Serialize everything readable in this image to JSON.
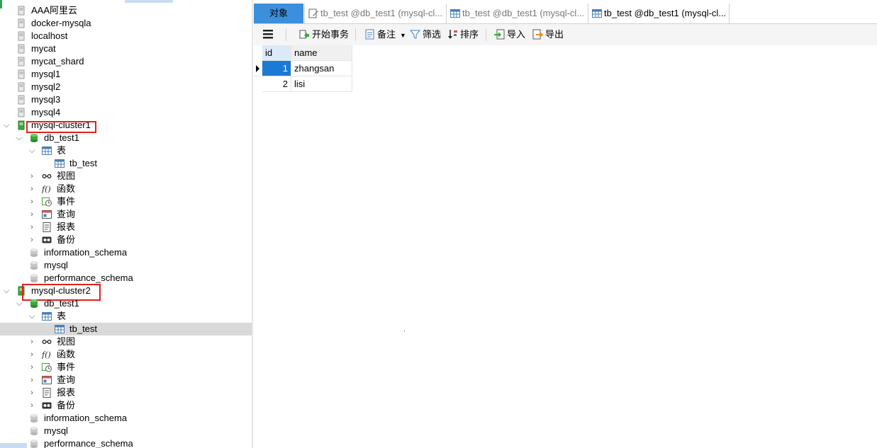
{
  "tree": {
    "connections_top": [
      "AAA阿里云",
      "docker-mysqla",
      "localhost",
      "mycat",
      "mycat_shard",
      "mysql1",
      "mysql2",
      "mysql3",
      "mysql4"
    ],
    "cluster1": {
      "name": "mysql-cluster1",
      "db": "db_test1",
      "tables_label": "表",
      "table": "tb_test",
      "views": "视图",
      "functions": "函数",
      "events": "事件",
      "queries": "查询",
      "reports": "报表",
      "backups": "备份",
      "other_dbs": [
        "information_schema",
        "mysql",
        "performance_schema"
      ]
    },
    "cluster2": {
      "name": "mysql-cluster2",
      "db": "db_test1",
      "tables_label": "表",
      "table": "tb_test",
      "views": "视图",
      "functions": "函数",
      "events": "事件",
      "queries": "查询",
      "reports": "报表",
      "backups": "备份",
      "other_dbs": [
        "information_schema",
        "mysql",
        "performance_schema"
      ]
    }
  },
  "tabs": {
    "objects": "对象",
    "doc1": "tb_test @db_test1 (mysql-cl...",
    "doc2": "tb_test @db_test1 (mysql-cl...",
    "doc3": "tb_test @db_test1 (mysql-cl..."
  },
  "toolbar": {
    "begin_transaction": "开始事务",
    "memo": "备注",
    "filter": "筛选",
    "sort": "排序",
    "import": "导入",
    "export": "导出"
  },
  "grid": {
    "columns": [
      "id",
      "name"
    ],
    "rows": [
      {
        "id": "1",
        "name": "zhangsan"
      },
      {
        "id": "2",
        "name": "lisi"
      }
    ]
  },
  "colors": {
    "accent_tab": "#3c8fdd",
    "selected_cell": "#1a7bd4",
    "highlight_box": "#e02020",
    "db_icon": "#3aa935"
  }
}
